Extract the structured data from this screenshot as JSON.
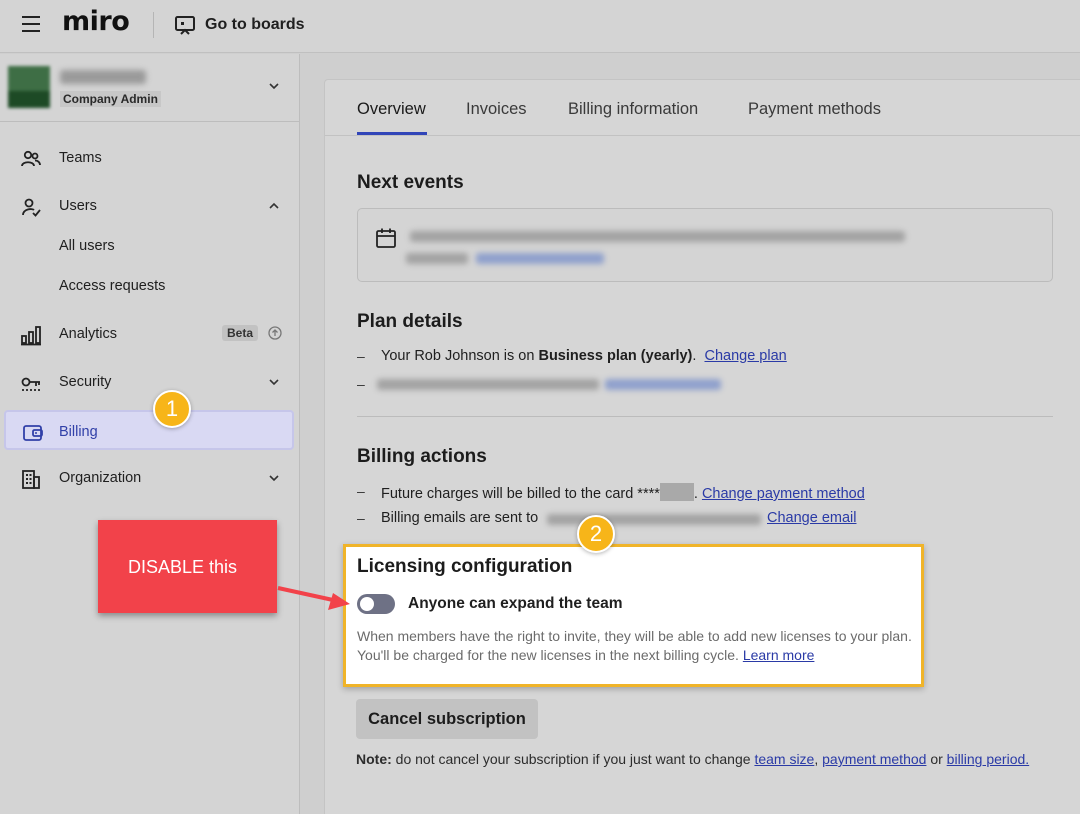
{
  "topbar": {
    "logo": "miro",
    "goto_boards": "Go to boards"
  },
  "account": {
    "role": "Company Admin"
  },
  "sidebar": {
    "items": [
      {
        "label": "Teams",
        "icon": "teams-icon"
      },
      {
        "label": "Users",
        "icon": "users-icon"
      },
      {
        "label": "All users"
      },
      {
        "label": "Access requests"
      },
      {
        "label": "Analytics",
        "icon": "analytics-icon",
        "badge": "Beta"
      },
      {
        "label": "Security",
        "icon": "security-icon"
      },
      {
        "label": "Billing",
        "icon": "wallet-icon",
        "selected": true
      },
      {
        "label": "Organization",
        "icon": "building-icon"
      }
    ]
  },
  "tabs": [
    {
      "label": "Overview",
      "active": true
    },
    {
      "label": "Invoices"
    },
    {
      "label": "Billing information"
    },
    {
      "label": "Payment methods"
    }
  ],
  "next_events": {
    "title": "Next events"
  },
  "plan_details": {
    "title": "Plan details",
    "line1_prefix": "Your Rob Johnson is on ",
    "line1_plan": "Business plan (yearly)",
    "line1_suffix": ".",
    "change_plan": "Change plan"
  },
  "billing_actions": {
    "title": "Billing actions",
    "charges_text": "Future charges will be billed to the card ****",
    "charges_suffix": ".",
    "change_payment": "Change payment method",
    "emails_text": "Billing emails are sent to",
    "change_email": "Change email"
  },
  "licensing": {
    "title": "Licensing configuration",
    "toggle_label": "Anyone can expand the team",
    "toggle_on": false,
    "description": "When members have the right to invite, they will be able to add new licenses to your plan. You'll be charged for the new licenses in the next billing cycle.",
    "learn_more": "Learn more"
  },
  "cancel": {
    "button": "Cancel subscription",
    "note_label": "Note:",
    "note_text": " do not cancel your subscription if you just want to change ",
    "link_team_size": "team size",
    "sep1": ", ",
    "link_payment": "payment method",
    "sep2": " or ",
    "link_billing_period": "billing period."
  },
  "annotations": {
    "badge1": "1",
    "badge2": "2",
    "callout": "DISABLE this",
    "colors": {
      "badge": "#f7b519",
      "callout": "#f2424a",
      "highlight_border": "#f0b429"
    }
  }
}
